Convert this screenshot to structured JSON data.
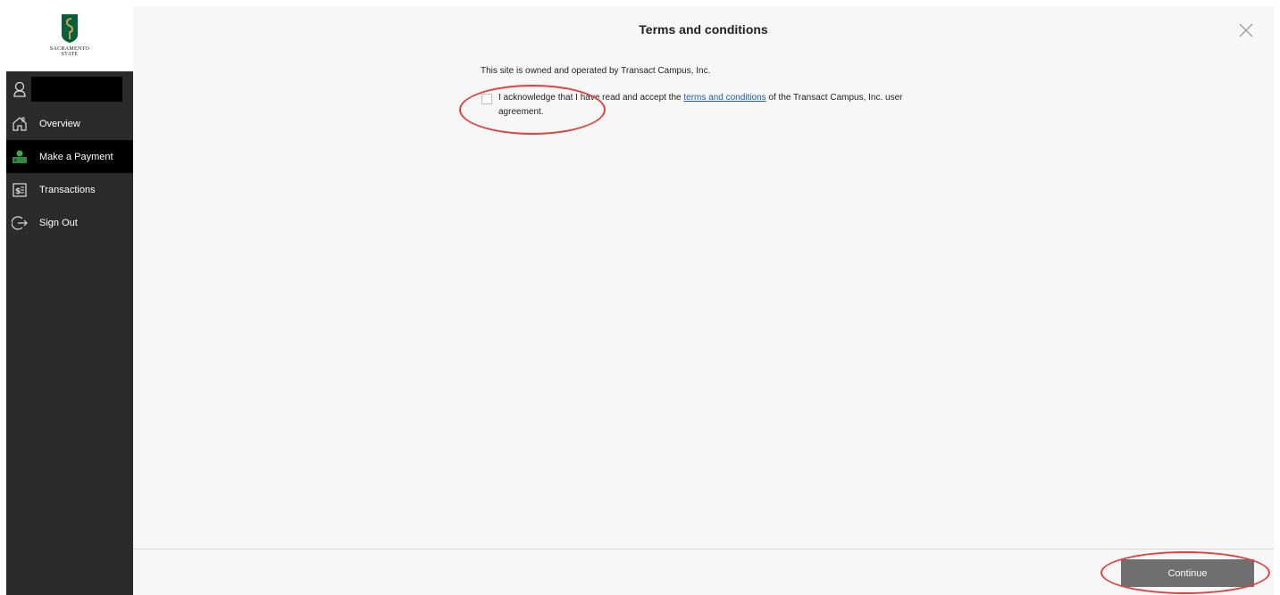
{
  "logo": {
    "text_line1": "SACRAMENTO",
    "text_line2": "STATE",
    "brand_green": "#0b5e3a",
    "brand_gold": "#c4a35a"
  },
  "user": {
    "name_redacted": ""
  },
  "nav": {
    "items": [
      {
        "label": "Overview",
        "icon": "house-icon",
        "active": false
      },
      {
        "label": "Make a Payment",
        "icon": "payment-icon",
        "active": true
      },
      {
        "label": "Transactions",
        "icon": "receipt-icon",
        "active": false
      },
      {
        "label": "Sign Out",
        "icon": "sign-out-icon",
        "active": false
      }
    ]
  },
  "modal": {
    "title": "Terms and conditions",
    "owned_text": "This site is owned and operated by Transact Campus, Inc.",
    "ack_prefix": "I acknowledge that I have read and accept the ",
    "ack_link": "terms and conditions",
    "ack_suffix": " of the Transact Campus, Inc. user agreement.",
    "checkbox_checked": false,
    "continue_label": "Continue"
  },
  "colors": {
    "sidebar_bg": "#2b2b2b",
    "active_item_bg": "#000000",
    "annotation_red": "#e04040",
    "link_blue": "#1d5fa5",
    "button_gray": "#6f6f6f"
  }
}
